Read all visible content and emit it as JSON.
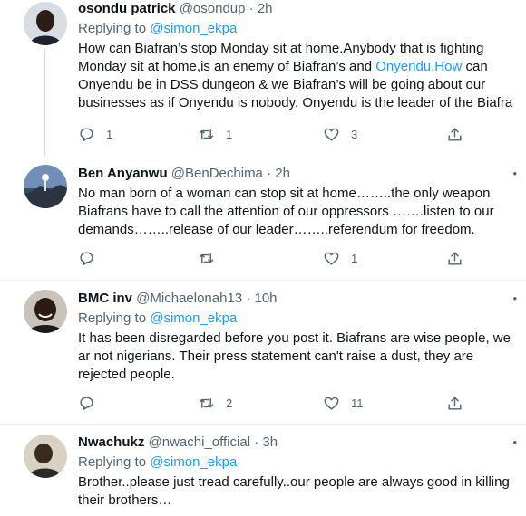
{
  "tweets": [
    {
      "name": "osondu patrick",
      "handle": "@osondup",
      "time": "2h",
      "replying_label": "Replying to",
      "replying_handle": "@simon_ekpa",
      "text_1": "How can Biafran’s stop Monday sit at home.Anybody that is fighting Monday sit at home,is an enemy of Biafran’s and ",
      "text_link": "Onyendu.How",
      "text_2": " can Onyendu be in DSS dungeon & we Biafran’s will be going about our businesses as if Onyendu is nobody. Onyendu is the leader of the Biafra",
      "replies": "1",
      "retweets": "1",
      "likes": "3"
    },
    {
      "name": "Ben Anyanwu",
      "handle": "@BenDechima",
      "time": "2h",
      "text": "No man born of a woman can stop sit at home……..the only weapon Biafrans have to call the attention of our oppressors …….listen to our demands……..release of our leader……..referendum for freedom.",
      "replies": "",
      "retweets": "",
      "likes": "1"
    },
    {
      "name": "BMC inv",
      "handle": "@Michaelonah13",
      "time": "10h",
      "replying_label": "Replying to",
      "replying_handle": "@simon_ekpa",
      "text": "It has been disregarded before you post it. Biafrans are wise people, we ar not nigerians. Their press statement can't raise a dust, they are rejected people.",
      "replies": "",
      "retweets": "2",
      "likes": "11"
    },
    {
      "name": "Nwachukz",
      "handle": "@nwachi_official",
      "time": "3h",
      "replying_label": "Replying to",
      "replying_handle": "@simon_ekpa",
      "text": "Brother..please just tread carefully..our people are always good in killing their brothers…"
    }
  ],
  "separator": "·",
  "more_glyph": "•",
  "colors": {
    "link": "#1d9bf0",
    "meta": "#536471",
    "divider": "#eff3f4"
  },
  "icons": [
    "reply-icon",
    "retweet-icon",
    "like-icon",
    "share-icon",
    "more-icon"
  ]
}
